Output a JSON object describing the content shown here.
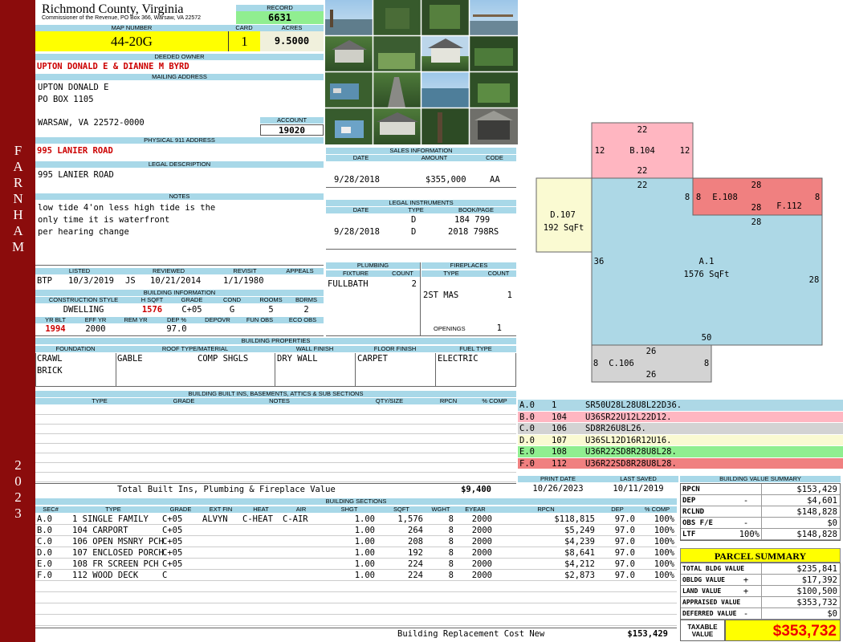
{
  "sidebar": {
    "town": "FARNHAM",
    "year": "2023"
  },
  "header": {
    "county": "Richmond County, Virginia",
    "commissioner": "Commissioner of the Revenue, PO Box 366, Warsaw, VA 22572",
    "record_label": "RECORD",
    "record": "6631",
    "map_label": "MAP NUMBER",
    "map": "44-20G",
    "card_label": "CARD",
    "card": "1",
    "acres_label": "ACRES",
    "acres": "9.5000"
  },
  "owner": {
    "label": "DEEDED OWNER",
    "name": "UPTON DONALD E & DIANNE M BYRD",
    "mail_label": "MAILING ADDRESS",
    "mail1": "UPTON DONALD E",
    "mail2": "PO BOX 1105",
    "mail3": "WARSAW, VA 22572-0000",
    "account_label": "ACCOUNT",
    "account": "19020",
    "addr_label": "PHYSICAL 911 ADDRESS",
    "addr": "995 LANIER ROAD",
    "legal_label": "LEGAL DESCRIPTION",
    "legal": "995 LANIER ROAD",
    "notes_label": "NOTES",
    "notes1": "low tide 4'on less high tide is the",
    "notes2": "only time it is waterfront",
    "notes3": "per hearing change"
  },
  "listing": {
    "listed_label": "LISTED",
    "listed_by": "BTP",
    "listed_date": "10/3/2019",
    "reviewed_label": "REVIEWED",
    "reviewed_by": "JS",
    "reviewed_date": "10/21/2014",
    "revisit_label": "REVISIT",
    "revisit": "1/1/1980",
    "appeals_label": "APPEALS"
  },
  "building_info": {
    "label": "BUILDING INFORMATION",
    "h": [
      "CONSTRUCTION STYLE",
      "H SQFT",
      "GRADE",
      "COND",
      "ROOMS",
      "BDRMS"
    ],
    "v": [
      "DWELLING",
      "1576",
      "C+05",
      "G",
      "5",
      "2"
    ],
    "h2": [
      "YR BLT",
      "EFF YR",
      "REM YR",
      "DEP %",
      "DEPOVR",
      "FUN OBS",
      "ECO OBS"
    ],
    "v2": [
      "1994",
      "2000",
      "",
      "97.0",
      "",
      "",
      ""
    ]
  },
  "sales": {
    "label": "SALES INFORMATION",
    "h": [
      "DATE",
      "AMOUNT",
      "CODE"
    ],
    "date": "9/28/2018",
    "amount": "$355,000",
    "code": "AA"
  },
  "legal_instr": {
    "label": "LEGAL INSTRUMENTS",
    "h": [
      "DATE",
      "TYPE",
      "BOOK/PAGE"
    ],
    "r1": [
      "",
      "D",
      "184 799"
    ],
    "r2": [
      "9/28/2018",
      "D",
      "2018 798RS"
    ]
  },
  "plumbing": {
    "label": "PLUMBING",
    "h": [
      "FIXTURE",
      "COUNT"
    ],
    "fixture": "FULLBATH",
    "count": "2"
  },
  "fireplaces": {
    "label": "FIREPLACES",
    "h": [
      "TYPE",
      "COUNT"
    ],
    "type": "2ST MAS",
    "count": "1",
    "openings_label": "OPENINGS",
    "openings": "1"
  },
  "properties": {
    "label": "BUILDING PROPERTIES",
    "h": [
      "FOUNDATION",
      "ROOF TYPE/MATERIAL",
      "WALL FINISH",
      "FLOOR FINISH",
      "FUEL TYPE"
    ],
    "foundation1": "CRAWL",
    "foundation2": "BRICK",
    "roof1": "GABLE",
    "roof2": "COMP SHGLS",
    "wall": "DRY WALL",
    "floor": "CARPET",
    "fuel": "ELECTRIC"
  },
  "builtins": {
    "label": "BUILDING BUILT INS, BASEMENTS, ATTICS & SUB SECTIONS",
    "h": [
      "TYPE",
      "GRADE",
      "NOTES",
      "QTY/SIZE",
      "RPCN",
      "% COMP"
    ],
    "total_label": "Total Built Ins, Plumbing & Fireplace Value",
    "total": "$9,400"
  },
  "sketch": {
    "labels": [
      {
        "t": "22"
      },
      {
        "t": "12"
      },
      {
        "t": "B.104"
      },
      {
        "t": "12"
      },
      {
        "t": "22"
      },
      {
        "t": "22"
      },
      {
        "t": "8"
      },
      {
        "t": "8"
      },
      {
        "t": "E.108"
      },
      {
        "t": "28"
      },
      {
        "t": "28"
      },
      {
        "t": "F.112"
      },
      {
        "t": "8"
      },
      {
        "t": "28"
      },
      {
        "t": "D.107"
      },
      {
        "t": "192 SqFt"
      },
      {
        "t": "36"
      },
      {
        "t": "A.1"
      },
      {
        "t": "1576 SqFt"
      },
      {
        "t": "28"
      },
      {
        "t": "50"
      },
      {
        "t": "26"
      },
      {
        "t": "8"
      },
      {
        "t": "C.106"
      },
      {
        "t": "8"
      },
      {
        "t": "26"
      }
    ]
  },
  "sections_legend": [
    {
      "a": "A.0",
      "b": "1",
      "c": "SR50U28L28U8L22D36.",
      "color": "#add8e6"
    },
    {
      "a": "B.0",
      "b": "104",
      "c": "U36SR22U12L22D12.",
      "color": "#ffb6c1"
    },
    {
      "a": "C.0",
      "b": "106",
      "c": "SD8R26U8L26.",
      "color": "#d3d3d3"
    },
    {
      "a": "D.0",
      "b": "107",
      "c": "U36SL12D16R12U16.",
      "color": "#fafad2"
    },
    {
      "a": "E.0",
      "b": "108",
      "c": "U36R22SD8R28U8L28.",
      "color": "#90ee90"
    },
    {
      "a": "F.0",
      "b": "112",
      "c": "U36R22SD8R28U8L28.",
      "color": "#f08080"
    }
  ],
  "dates": {
    "print_label": "PRINT DATE",
    "print": "10/26/2023",
    "saved_label": "LAST SAVED",
    "saved": "10/11/2019"
  },
  "value_summary": {
    "label": "BUILDING VALUE SUMMARY",
    "rows": [
      {
        "k": "RPCN",
        "s": "",
        "v": "$153,429"
      },
      {
        "k": "DEP",
        "s": "-",
        "v": "$4,601"
      },
      {
        "k": "RCLND",
        "s": "",
        "v": "$148,828"
      },
      {
        "k": "OBS F/E",
        "s": "-",
        "v": "$0"
      },
      {
        "k": "LTF",
        "s": "100%",
        "v": "$148,828"
      }
    ]
  },
  "parcel": {
    "label": "PARCEL SUMMARY",
    "rows": [
      {
        "k": "TOTAL BLDG VALUE",
        "s": "",
        "v": "$235,841"
      },
      {
        "k": "OBLDG VALUE",
        "s": "+",
        "v": "$17,392"
      },
      {
        "k": "LAND VALUE",
        "s": "+",
        "v": "$100,500"
      },
      {
        "k": "APPRAISED VALUE",
        "s": "",
        "v": "$353,732"
      },
      {
        "k": "DEFERRED VALUE",
        "s": "-",
        "v": "$0"
      }
    ],
    "taxable_label1": "TAXABLE",
    "taxable_label2": "VALUE",
    "taxable": "$353,732"
  },
  "sections": {
    "label": "BUILDING SECTIONS",
    "h": [
      "SEC#",
      "TYPE",
      "GRADE",
      "EXT FIN",
      "HEAT",
      "AIR",
      "SHGT",
      "SQFT",
      "WGHT",
      "EYEAR",
      "RPCN",
      "DEP",
      "% COMP"
    ],
    "rows": [
      [
        "A.0",
        "1 SINGLE FAMILY",
        "C+05",
        "ALVYN",
        "C-HEAT",
        "C-AIR",
        "1.00",
        "1,576",
        "8",
        "2000",
        "$118,815",
        "97.0",
        "100%"
      ],
      [
        "B.0",
        "104 CARPORT",
        "C+05",
        "",
        "",
        "",
        "1.00",
        "264",
        "8",
        "2000",
        "$5,249",
        "97.0",
        "100%"
      ],
      [
        "C.0",
        "106 OPEN MSNRY PCH",
        "C+05",
        "",
        "",
        "",
        "1.00",
        "208",
        "8",
        "2000",
        "$4,239",
        "97.0",
        "100%"
      ],
      [
        "D.0",
        "107 ENCLOSED PORCH",
        "C+05",
        "",
        "",
        "",
        "1.00",
        "192",
        "8",
        "2000",
        "$8,641",
        "97.0",
        "100%"
      ],
      [
        "E.0",
        "108 FR SCREEN PCH",
        "C+05",
        "",
        "",
        "",
        "1.00",
        "224",
        "8",
        "2000",
        "$4,212",
        "97.0",
        "100%"
      ],
      [
        "F.0",
        "112 WOOD DECK",
        "C",
        "",
        "",
        "",
        "1.00",
        "224",
        "8",
        "2000",
        "$2,873",
        "97.0",
        "100%"
      ]
    ],
    "total_label": "Building Replacement Cost New",
    "total": "$153,429"
  }
}
